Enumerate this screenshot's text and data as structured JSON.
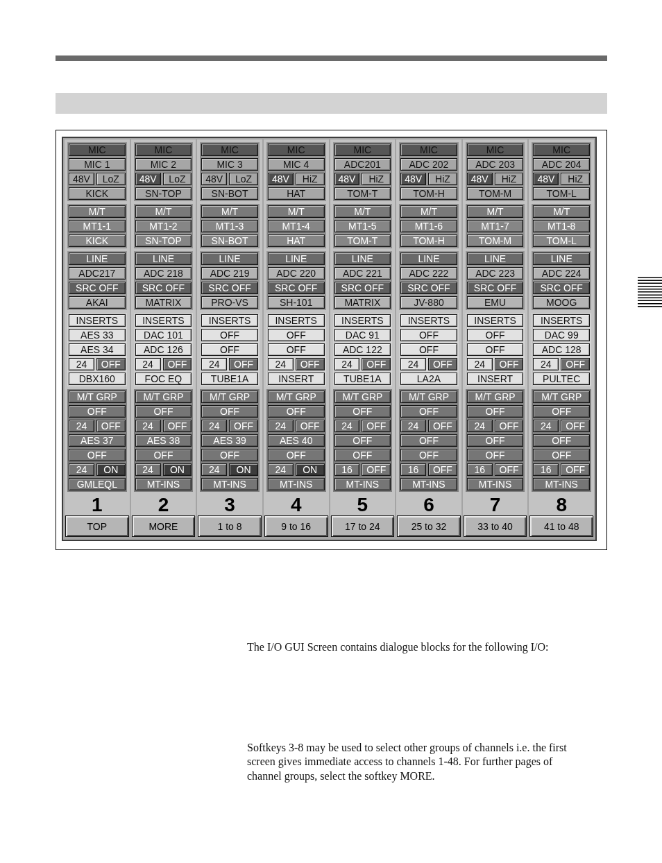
{
  "io_screen": {
    "strips": [
      {
        "number": "1",
        "blocks": [
          {
            "kind": "mic",
            "title": "MIC",
            "rows": [
              [
                {
                  "kind": "value",
                  "label": "MIC 1"
                }
              ],
              [
                {
                  "kind": "toggle",
                  "label": "48V",
                  "on": false
                },
                {
                  "kind": "value",
                  "label": "LoZ"
                }
              ],
              [
                {
                  "kind": "value",
                  "label": "KICK"
                }
              ]
            ]
          },
          {
            "kind": "mt",
            "title": "M/T",
            "rows": [
              [
                {
                  "kind": "value",
                  "label": "MT1-1"
                }
              ],
              [
                {
                  "kind": "value",
                  "label": "KICK"
                }
              ]
            ]
          },
          {
            "kind": "line",
            "title": "LINE",
            "rows": [
              [
                {
                  "kind": "value",
                  "label": "ADC217"
                }
              ],
              [
                {
                  "kind": "switch",
                  "label": "SRC OFF"
                }
              ],
              [
                {
                  "kind": "value",
                  "label": "AKAI"
                }
              ]
            ]
          },
          {
            "kind": "inserts",
            "title": "INSERTS",
            "rows": [
              [
                {
                  "kind": "value",
                  "label": "AES 33"
                }
              ],
              [
                {
                  "kind": "value",
                  "label": "AES 34"
                }
              ],
              [
                {
                  "kind": "value",
                  "label": "24"
                },
                {
                  "kind": "switch",
                  "label": "OFF"
                }
              ],
              [
                {
                  "kind": "value",
                  "label": "DBX160"
                }
              ]
            ]
          },
          {
            "kind": "mt_grp",
            "title": "M/T GRP",
            "rows": [
              [
                {
                  "kind": "value",
                  "label": "OFF"
                }
              ],
              [
                {
                  "kind": "value",
                  "label": "24"
                },
                {
                  "kind": "switch",
                  "label": "OFF"
                }
              ],
              [
                {
                  "kind": "value",
                  "label": "AES 37"
                }
              ],
              [
                {
                  "kind": "value",
                  "label": "OFF"
                }
              ],
              [
                {
                  "kind": "value",
                  "label": "24"
                },
                {
                  "kind": "toggle",
                  "label": "ON",
                  "on": true
                }
              ],
              [
                {
                  "kind": "value",
                  "label": "GMLEQL"
                }
              ]
            ]
          }
        ]
      },
      {
        "number": "2",
        "blocks": [
          {
            "kind": "mic",
            "title": "MIC",
            "rows": [
              [
                {
                  "kind": "value",
                  "label": "MIC 2"
                }
              ],
              [
                {
                  "kind": "toggle",
                  "label": "48V",
                  "on": true
                },
                {
                  "kind": "value",
                  "label": "LoZ"
                }
              ],
              [
                {
                  "kind": "value",
                  "label": "SN-TOP"
                }
              ]
            ]
          },
          {
            "kind": "mt",
            "title": "M/T",
            "rows": [
              [
                {
                  "kind": "value",
                  "label": "MT1-2"
                }
              ],
              [
                {
                  "kind": "value",
                  "label": "SN-TOP"
                }
              ]
            ]
          },
          {
            "kind": "line",
            "title": "LINE",
            "rows": [
              [
                {
                  "kind": "value",
                  "label": "ADC 218"
                }
              ],
              [
                {
                  "kind": "switch",
                  "label": "SRC OFF"
                }
              ],
              [
                {
                  "kind": "value",
                  "label": "MATRIX"
                }
              ]
            ]
          },
          {
            "kind": "inserts",
            "title": "INSERTS",
            "rows": [
              [
                {
                  "kind": "value",
                  "label": "DAC 101"
                }
              ],
              [
                {
                  "kind": "value",
                  "label": "ADC 126"
                }
              ],
              [
                {
                  "kind": "value",
                  "label": "24"
                },
                {
                  "kind": "switch",
                  "label": "OFF"
                }
              ],
              [
                {
                  "kind": "value",
                  "label": "FOC EQ"
                }
              ]
            ]
          },
          {
            "kind": "mt_grp",
            "title": "M/T GRP",
            "rows": [
              [
                {
                  "kind": "value",
                  "label": "OFF"
                }
              ],
              [
                {
                  "kind": "value",
                  "label": "24"
                },
                {
                  "kind": "switch",
                  "label": "OFF"
                }
              ],
              [
                {
                  "kind": "value",
                  "label": "AES 38"
                }
              ],
              [
                {
                  "kind": "value",
                  "label": "OFF"
                }
              ],
              [
                {
                  "kind": "value",
                  "label": "24"
                },
                {
                  "kind": "toggle",
                  "label": "ON",
                  "on": true
                }
              ],
              [
                {
                  "kind": "value",
                  "label": "MT-INS"
                }
              ]
            ]
          }
        ]
      },
      {
        "number": "3",
        "blocks": [
          {
            "kind": "mic",
            "title": "MIC",
            "rows": [
              [
                {
                  "kind": "value",
                  "label": "MIC 3"
                }
              ],
              [
                {
                  "kind": "toggle",
                  "label": "48V",
                  "on": false
                },
                {
                  "kind": "value",
                  "label": "LoZ"
                }
              ],
              [
                {
                  "kind": "value",
                  "label": "SN-BOT"
                }
              ]
            ]
          },
          {
            "kind": "mt",
            "title": "M/T",
            "rows": [
              [
                {
                  "kind": "value",
                  "label": "MT1-3"
                }
              ],
              [
                {
                  "kind": "value",
                  "label": "SN-BOT"
                }
              ]
            ]
          },
          {
            "kind": "line",
            "title": "LINE",
            "rows": [
              [
                {
                  "kind": "value",
                  "label": "ADC 219"
                }
              ],
              [
                {
                  "kind": "switch",
                  "label": "SRC OFF"
                }
              ],
              [
                {
                  "kind": "value",
                  "label": "PRO-VS"
                }
              ]
            ]
          },
          {
            "kind": "inserts",
            "title": "INSERTS",
            "rows": [
              [
                {
                  "kind": "value",
                  "label": "OFF"
                }
              ],
              [
                {
                  "kind": "value",
                  "label": "OFF"
                }
              ],
              [
                {
                  "kind": "value",
                  "label": "24"
                },
                {
                  "kind": "switch",
                  "label": "OFF"
                }
              ],
              [
                {
                  "kind": "value",
                  "label": "TUBE1A"
                }
              ]
            ]
          },
          {
            "kind": "mt_grp",
            "title": "M/T GRP",
            "rows": [
              [
                {
                  "kind": "value",
                  "label": "OFF"
                }
              ],
              [
                {
                  "kind": "value",
                  "label": "24"
                },
                {
                  "kind": "switch",
                  "label": "OFF"
                }
              ],
              [
                {
                  "kind": "value",
                  "label": "AES 39"
                }
              ],
              [
                {
                  "kind": "value",
                  "label": "OFF"
                }
              ],
              [
                {
                  "kind": "value",
                  "label": "24"
                },
                {
                  "kind": "toggle",
                  "label": "ON",
                  "on": true
                }
              ],
              [
                {
                  "kind": "value",
                  "label": "MT-INS"
                }
              ]
            ]
          }
        ]
      },
      {
        "number": "4",
        "blocks": [
          {
            "kind": "mic",
            "title": "MIC",
            "rows": [
              [
                {
                  "kind": "value",
                  "label": "MIC 4"
                }
              ],
              [
                {
                  "kind": "toggle",
                  "label": "48V",
                  "on": true
                },
                {
                  "kind": "value",
                  "label": "HiZ"
                }
              ],
              [
                {
                  "kind": "value",
                  "label": "HAT"
                }
              ]
            ]
          },
          {
            "kind": "mt",
            "title": "M/T",
            "rows": [
              [
                {
                  "kind": "value",
                  "label": "MT1-4"
                }
              ],
              [
                {
                  "kind": "value",
                  "label": "HAT"
                }
              ]
            ]
          },
          {
            "kind": "line",
            "title": "LINE",
            "rows": [
              [
                {
                  "kind": "value",
                  "label": "ADC 220"
                }
              ],
              [
                {
                  "kind": "switch",
                  "label": "SRC OFF"
                }
              ],
              [
                {
                  "kind": "value",
                  "label": "SH-101"
                }
              ]
            ]
          },
          {
            "kind": "inserts",
            "title": "INSERTS",
            "rows": [
              [
                {
                  "kind": "value",
                  "label": "OFF"
                }
              ],
              [
                {
                  "kind": "value",
                  "label": "OFF"
                }
              ],
              [
                {
                  "kind": "value",
                  "label": "24"
                },
                {
                  "kind": "switch",
                  "label": "OFF"
                }
              ],
              [
                {
                  "kind": "value",
                  "label": "INSERT"
                }
              ]
            ]
          },
          {
            "kind": "mt_grp",
            "title": "M/T GRP",
            "rows": [
              [
                {
                  "kind": "value",
                  "label": "OFF"
                }
              ],
              [
                {
                  "kind": "value",
                  "label": "24"
                },
                {
                  "kind": "switch",
                  "label": "OFF"
                }
              ],
              [
                {
                  "kind": "value",
                  "label": "AES 40"
                }
              ],
              [
                {
                  "kind": "value",
                  "label": "OFF"
                }
              ],
              [
                {
                  "kind": "value",
                  "label": "24"
                },
                {
                  "kind": "toggle",
                  "label": "ON",
                  "on": true
                }
              ],
              [
                {
                  "kind": "value",
                  "label": "MT-INS"
                }
              ]
            ]
          }
        ]
      },
      {
        "number": "5",
        "blocks": [
          {
            "kind": "mic",
            "title": "MIC",
            "rows": [
              [
                {
                  "kind": "value",
                  "label": "ADC201"
                }
              ],
              [
                {
                  "kind": "toggle",
                  "label": "48V",
                  "on": true
                },
                {
                  "kind": "value",
                  "label": "HiZ"
                }
              ],
              [
                {
                  "kind": "value",
                  "label": "TOM-T"
                }
              ]
            ]
          },
          {
            "kind": "mt",
            "title": "M/T",
            "rows": [
              [
                {
                  "kind": "value",
                  "label": "MT1-5"
                }
              ],
              [
                {
                  "kind": "value",
                  "label": "TOM-T"
                }
              ]
            ]
          },
          {
            "kind": "line",
            "title": "LINE",
            "rows": [
              [
                {
                  "kind": "value",
                  "label": "ADC 221"
                }
              ],
              [
                {
                  "kind": "switch",
                  "label": "SRC OFF"
                }
              ],
              [
                {
                  "kind": "value",
                  "label": "MATRIX"
                }
              ]
            ]
          },
          {
            "kind": "inserts",
            "title": "INSERTS",
            "rows": [
              [
                {
                  "kind": "value",
                  "label": "DAC 91"
                }
              ],
              [
                {
                  "kind": "value",
                  "label": "ADC 122"
                }
              ],
              [
                {
                  "kind": "value",
                  "label": "24"
                },
                {
                  "kind": "switch",
                  "label": "OFF"
                }
              ],
              [
                {
                  "kind": "value",
                  "label": "TUBE1A"
                }
              ]
            ]
          },
          {
            "kind": "mt_grp",
            "title": "M/T GRP",
            "rows": [
              [
                {
                  "kind": "value",
                  "label": "OFF"
                }
              ],
              [
                {
                  "kind": "value",
                  "label": "24"
                },
                {
                  "kind": "switch",
                  "label": "OFF"
                }
              ],
              [
                {
                  "kind": "value",
                  "label": "OFF"
                }
              ],
              [
                {
                  "kind": "value",
                  "label": "OFF"
                }
              ],
              [
                {
                  "kind": "value",
                  "label": "16"
                },
                {
                  "kind": "toggle",
                  "label": "OFF",
                  "on": false
                }
              ],
              [
                {
                  "kind": "value",
                  "label": "MT-INS"
                }
              ]
            ]
          }
        ]
      },
      {
        "number": "6",
        "blocks": [
          {
            "kind": "mic",
            "title": "MIC",
            "rows": [
              [
                {
                  "kind": "value",
                  "label": "ADC 202"
                }
              ],
              [
                {
                  "kind": "toggle",
                  "label": "48V",
                  "on": true
                },
                {
                  "kind": "value",
                  "label": "HiZ"
                }
              ],
              [
                {
                  "kind": "value",
                  "label": "TOM-H"
                }
              ]
            ]
          },
          {
            "kind": "mt",
            "title": "M/T",
            "rows": [
              [
                {
                  "kind": "value",
                  "label": "MT1-6"
                }
              ],
              [
                {
                  "kind": "value",
                  "label": "TOM-H"
                }
              ]
            ]
          },
          {
            "kind": "line",
            "title": "LINE",
            "rows": [
              [
                {
                  "kind": "value",
                  "label": "ADC 222"
                }
              ],
              [
                {
                  "kind": "switch",
                  "label": "SRC OFF"
                }
              ],
              [
                {
                  "kind": "value",
                  "label": "JV-880"
                }
              ]
            ]
          },
          {
            "kind": "inserts",
            "title": "INSERTS",
            "rows": [
              [
                {
                  "kind": "value",
                  "label": "OFF"
                }
              ],
              [
                {
                  "kind": "value",
                  "label": "OFF"
                }
              ],
              [
                {
                  "kind": "value",
                  "label": "24"
                },
                {
                  "kind": "switch",
                  "label": "OFF"
                }
              ],
              [
                {
                  "kind": "value",
                  "label": "LA2A"
                }
              ]
            ]
          },
          {
            "kind": "mt_grp",
            "title": "M/T GRP",
            "rows": [
              [
                {
                  "kind": "value",
                  "label": "OFF"
                }
              ],
              [
                {
                  "kind": "value",
                  "label": "24"
                },
                {
                  "kind": "switch",
                  "label": "OFF"
                }
              ],
              [
                {
                  "kind": "value",
                  "label": "OFF"
                }
              ],
              [
                {
                  "kind": "value",
                  "label": "OFF"
                }
              ],
              [
                {
                  "kind": "value",
                  "label": "16"
                },
                {
                  "kind": "toggle",
                  "label": "OFF",
                  "on": false
                }
              ],
              [
                {
                  "kind": "value",
                  "label": "MT-INS"
                }
              ]
            ]
          }
        ]
      },
      {
        "number": "7",
        "blocks": [
          {
            "kind": "mic",
            "title": "MIC",
            "rows": [
              [
                {
                  "kind": "value",
                  "label": "ADC 203"
                }
              ],
              [
                {
                  "kind": "toggle",
                  "label": "48V",
                  "on": true
                },
                {
                  "kind": "value",
                  "label": "HiZ"
                }
              ],
              [
                {
                  "kind": "value",
                  "label": "TOM-M"
                }
              ]
            ]
          },
          {
            "kind": "mt",
            "title": "M/T",
            "rows": [
              [
                {
                  "kind": "value",
                  "label": "MT1-7"
                }
              ],
              [
                {
                  "kind": "value",
                  "label": "TOM-M"
                }
              ]
            ]
          },
          {
            "kind": "line",
            "title": "LINE",
            "rows": [
              [
                {
                  "kind": "value",
                  "label": "ADC 223"
                }
              ],
              [
                {
                  "kind": "switch",
                  "label": "SRC OFF"
                }
              ],
              [
                {
                  "kind": "value",
                  "label": "EMU"
                }
              ]
            ]
          },
          {
            "kind": "inserts",
            "title": "INSERTS",
            "rows": [
              [
                {
                  "kind": "value",
                  "label": "OFF"
                }
              ],
              [
                {
                  "kind": "value",
                  "label": "OFF"
                }
              ],
              [
                {
                  "kind": "value",
                  "label": "24"
                },
                {
                  "kind": "switch",
                  "label": "OFF"
                }
              ],
              [
                {
                  "kind": "value",
                  "label": "INSERT"
                }
              ]
            ]
          },
          {
            "kind": "mt_grp",
            "title": "M/T GRP",
            "rows": [
              [
                {
                  "kind": "value",
                  "label": "OFF"
                }
              ],
              [
                {
                  "kind": "value",
                  "label": "24"
                },
                {
                  "kind": "switch",
                  "label": "OFF"
                }
              ],
              [
                {
                  "kind": "value",
                  "label": "OFF"
                }
              ],
              [
                {
                  "kind": "value",
                  "label": "OFF"
                }
              ],
              [
                {
                  "kind": "value",
                  "label": "16"
                },
                {
                  "kind": "toggle",
                  "label": "OFF",
                  "on": false
                }
              ],
              [
                {
                  "kind": "value",
                  "label": "MT-INS"
                }
              ]
            ]
          }
        ]
      },
      {
        "number": "8",
        "blocks": [
          {
            "kind": "mic",
            "title": "MIC",
            "rows": [
              [
                {
                  "kind": "value",
                  "label": "ADC 204"
                }
              ],
              [
                {
                  "kind": "toggle",
                  "label": "48V",
                  "on": true
                },
                {
                  "kind": "value",
                  "label": "HiZ"
                }
              ],
              [
                {
                  "kind": "value",
                  "label": "TOM-L"
                }
              ]
            ]
          },
          {
            "kind": "mt",
            "title": "M/T",
            "rows": [
              [
                {
                  "kind": "value",
                  "label": "MT1-8"
                }
              ],
              [
                {
                  "kind": "value",
                  "label": "TOM-L"
                }
              ]
            ]
          },
          {
            "kind": "line",
            "title": "LINE",
            "rows": [
              [
                {
                  "kind": "value",
                  "label": "ADC 224"
                }
              ],
              [
                {
                  "kind": "switch",
                  "label": "SRC OFF"
                }
              ],
              [
                {
                  "kind": "value",
                  "label": "MOOG"
                }
              ]
            ]
          },
          {
            "kind": "inserts",
            "title": "INSERTS",
            "rows": [
              [
                {
                  "kind": "value",
                  "label": "DAC 99"
                }
              ],
              [
                {
                  "kind": "value",
                  "label": "ADC 128"
                }
              ],
              [
                {
                  "kind": "value",
                  "label": "24"
                },
                {
                  "kind": "switch",
                  "label": "OFF"
                }
              ],
              [
                {
                  "kind": "value",
                  "label": "PULTEC"
                }
              ]
            ]
          },
          {
            "kind": "mt_grp",
            "title": "M/T GRP",
            "rows": [
              [
                {
                  "kind": "value",
                  "label": "OFF"
                }
              ],
              [
                {
                  "kind": "value",
                  "label": "24"
                },
                {
                  "kind": "switch",
                  "label": "OFF"
                }
              ],
              [
                {
                  "kind": "value",
                  "label": "OFF"
                }
              ],
              [
                {
                  "kind": "value",
                  "label": "OFF"
                }
              ],
              [
                {
                  "kind": "value",
                  "label": "16"
                },
                {
                  "kind": "toggle",
                  "label": "OFF",
                  "on": false
                }
              ],
              [
                {
                  "kind": "value",
                  "label": "MT-INS"
                }
              ]
            ]
          }
        ]
      }
    ],
    "softkeys": [
      "TOP",
      "MORE",
      "1 to 8",
      "9 to 16",
      "17 to 24",
      "25 to 32",
      "33 to 40",
      "41 to 48"
    ]
  },
  "paragraphs": [
    "The I/O GUI Screen contains dialogue blocks for the following I/O:",
    "Softkeys 3-8 may be used to select other groups of channels i.e. the first screen gives immediate access to channels 1-48. For further pages of channel groups, select the softkey MORE."
  ]
}
